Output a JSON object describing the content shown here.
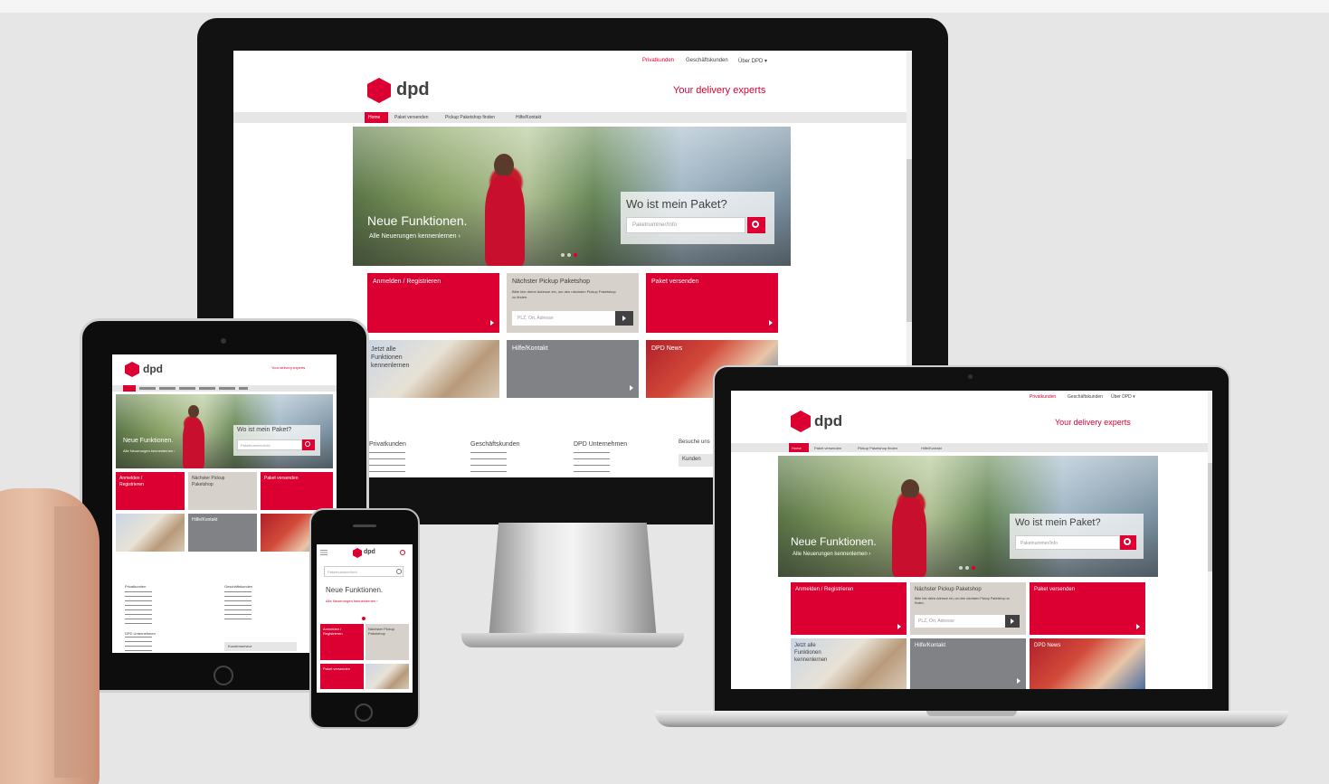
{
  "brand": {
    "name": "dpd",
    "tagline": "Your delivery experts",
    "accent": "#dc0032",
    "dark": "#414042"
  },
  "topbar": {
    "privat": "Privatkunden",
    "geschaeft": "Geschäftskunden",
    "ueber": "Über DPD ▾"
  },
  "nav": {
    "home": "Home",
    "items": [
      "Paket versenden",
      "Pickup Paketshop finden",
      "Hilfe/Kontakt"
    ]
  },
  "hero": {
    "title": "Neue Funktionen.",
    "subtitle": "Alle Neuerungen kennenlernen ›",
    "track_title": "Wo ist mein Paket?",
    "track_placeholder": "Paketnummer/Info"
  },
  "tiles": {
    "login": "Anmelden / Registrieren",
    "pickup": "Nächster Pickup Paketshop",
    "pickup_desc": "Bitte hier deine Adresse ein, um den nächsten Pickup Paketshop zu finden.",
    "pickup_placeholder": "PLZ, Ort, Adresse",
    "send": "Paket versenden",
    "features": "Jetzt alle Funktionen kennenlernen",
    "help": "Hilfe/Kontakt",
    "news": "DPD News"
  },
  "footer": {
    "privat": "Privatkunden",
    "geschaeft": "Geschäftskunden",
    "unternehmen": "DPD Unternehmen",
    "besuche": "Besuche uns",
    "kunden": "Kunden"
  },
  "phone": {
    "search_placeholder": "Paketnummer/Info",
    "hero_title": "Neue Funktionen.",
    "hero_sub": "Alle Neuerungen kennenlernen ›",
    "tile_login": "Anmelden / Registrieren",
    "tile_pickup": "Nächster Pickup Paketshop",
    "tile_send": "Paket versenden"
  },
  "tablet": {
    "tile_login": "Anmelden / Registrieren",
    "tile_pickup": "Nächster Pickup Paketshop",
    "tile_send": "Paket versenden",
    "tile_help": "Hilfe/Kontakt",
    "footer_privat": "Privatkunden",
    "footer_geschaeft": "Geschäftskunden",
    "footer_unternehmen": "DPD Unternehmen",
    "kunden": "Kundenservice"
  }
}
